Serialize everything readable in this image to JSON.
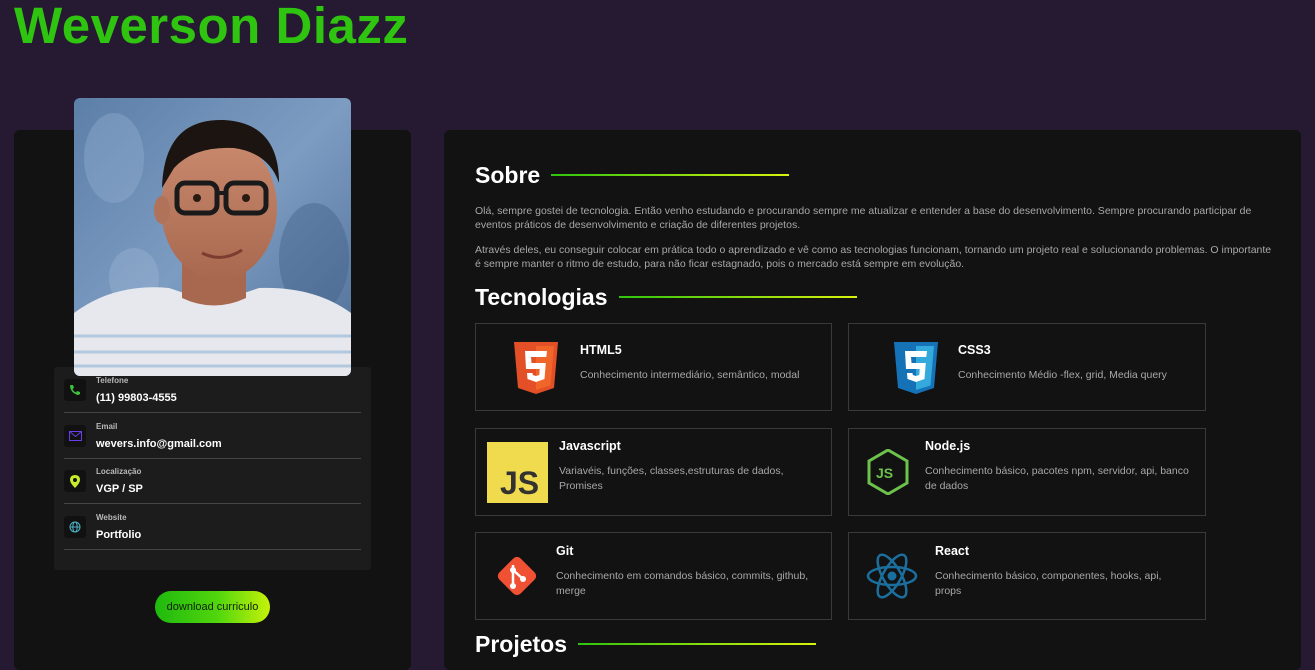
{
  "header": {
    "title": "Weverson Diazz"
  },
  "profile": {
    "contacts": [
      {
        "label": "Telefone",
        "value": "(11) 99803-4555",
        "icon": "phone-icon"
      },
      {
        "label": "Email",
        "value": "wevers.info@gmail.com",
        "icon": "mail-icon"
      },
      {
        "label": "Localização",
        "value": "VGP / SP",
        "icon": "location-pin-icon"
      },
      {
        "label": "Website",
        "value": "Portfolio",
        "icon": "globe-icon"
      }
    ],
    "download_label": "download curriculo"
  },
  "about": {
    "heading": "Sobre",
    "paragraphs": [
      "Olá, sempre gostei de tecnologia. Então venho estudando e procurando sempre me atualizar e entender a base do desenvolvimento. Sempre procurando participar de eventos práticos de desenvolvimento e criação de diferentes projetos.",
      "Através deles, eu conseguir colocar em prática todo o aprendizado e vê como as tecnologias funcionam, tornando um projeto real e solucionando problemas. O importante é sempre manter o ritmo de estudo, para não ficar estagnado, pois o mercado está sempre em evolução."
    ]
  },
  "technologies": {
    "heading": "Tecnologias",
    "items": [
      {
        "name": "HTML5",
        "desc": "Conhecimento intermediário, semântico, modal",
        "icon": "html5-icon",
        "color": "#e34f26"
      },
      {
        "name": "CSS3",
        "desc": "Conhecimento Médio -flex, grid, Media query",
        "icon": "css3-icon",
        "color": "#1572b6"
      },
      {
        "name": "Javascript",
        "desc": "Variavéis, funções, classes,estruturas de dados, Promises",
        "icon": "javascript-icon",
        "color": "#f0db4f"
      },
      {
        "name": "Node.js",
        "desc": "Conhecimento básico, pacotes npm, servidor, api, banco de dados",
        "icon": "nodejs-icon",
        "color": "#6cc24a"
      },
      {
        "name": "Git",
        "desc": "Conhecimento em comandos básico, commits, github, merge",
        "icon": "git-icon",
        "color": "#f05133"
      },
      {
        "name": "React",
        "desc": "Conhecimento básico, componentes, hooks, api, props",
        "icon": "react-icon",
        "color": "#1b6f9e"
      }
    ]
  },
  "projects": {
    "heading": "Projetos"
  },
  "colors": {
    "accent": "#2fc40f",
    "background": "#261a32",
    "card": "#121212"
  }
}
